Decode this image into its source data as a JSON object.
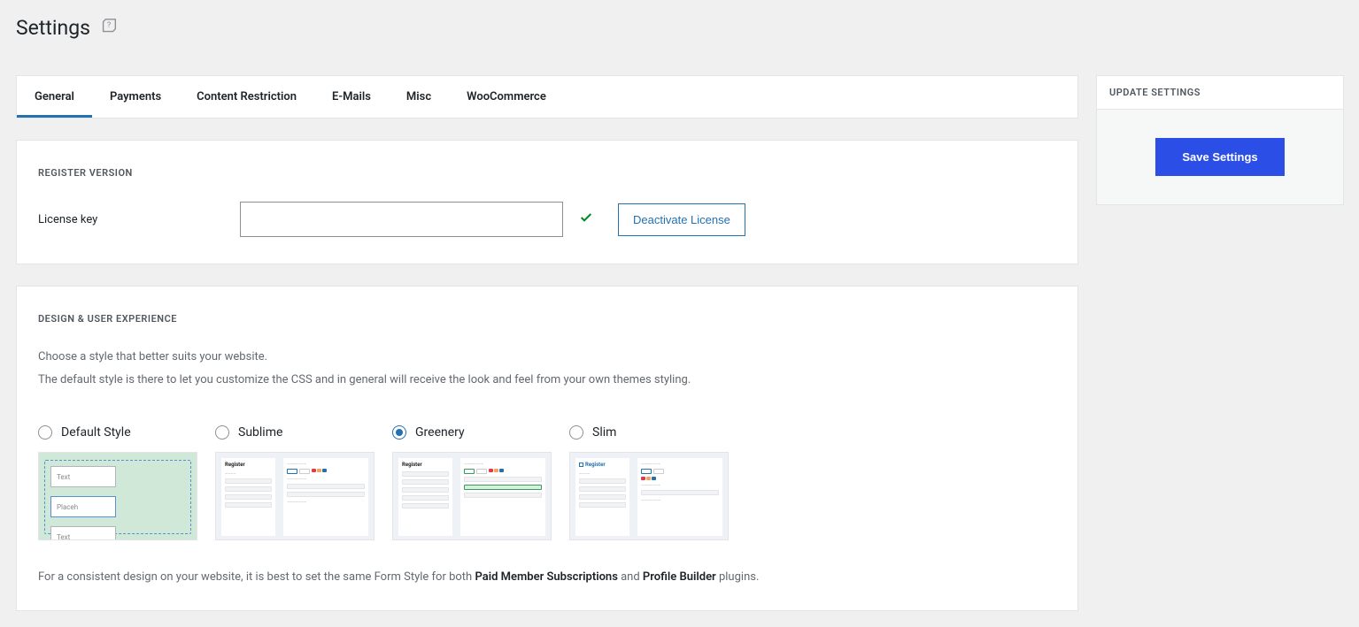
{
  "page": {
    "title": "Settings"
  },
  "tabs": {
    "general": "General",
    "payments": "Payments",
    "restriction": "Content Restriction",
    "emails": "E-Mails",
    "misc": "Misc",
    "woo": "WooCommerce"
  },
  "register": {
    "heading": "REGISTER VERSION",
    "license_label": "License key",
    "license_value": "",
    "deactivate": "Deactivate License"
  },
  "design": {
    "heading": "DESIGN & USER EXPERIENCE",
    "desc1": "Choose a style that better suits your website.",
    "desc2": "The default style is there to let you customize the CSS and in general will receive the look and feel from your own themes styling.",
    "options": {
      "default": "Default Style",
      "sublime": "Sublime",
      "greenery": "Greenery",
      "slim": "Slim",
      "selected": "greenery"
    },
    "preview": {
      "text": "Text",
      "placeholder": "Placeh",
      "register": "Register"
    },
    "footnote_a": "For a consistent design on your website, it is best to set the same Form Style for both ",
    "footnote_b": "Paid Member Subscriptions",
    "footnote_c": " and ",
    "footnote_d": "Profile Builder",
    "footnote_e": " plugins."
  },
  "sidebar": {
    "heading": "UPDATE SETTINGS",
    "save": "Save Settings"
  }
}
